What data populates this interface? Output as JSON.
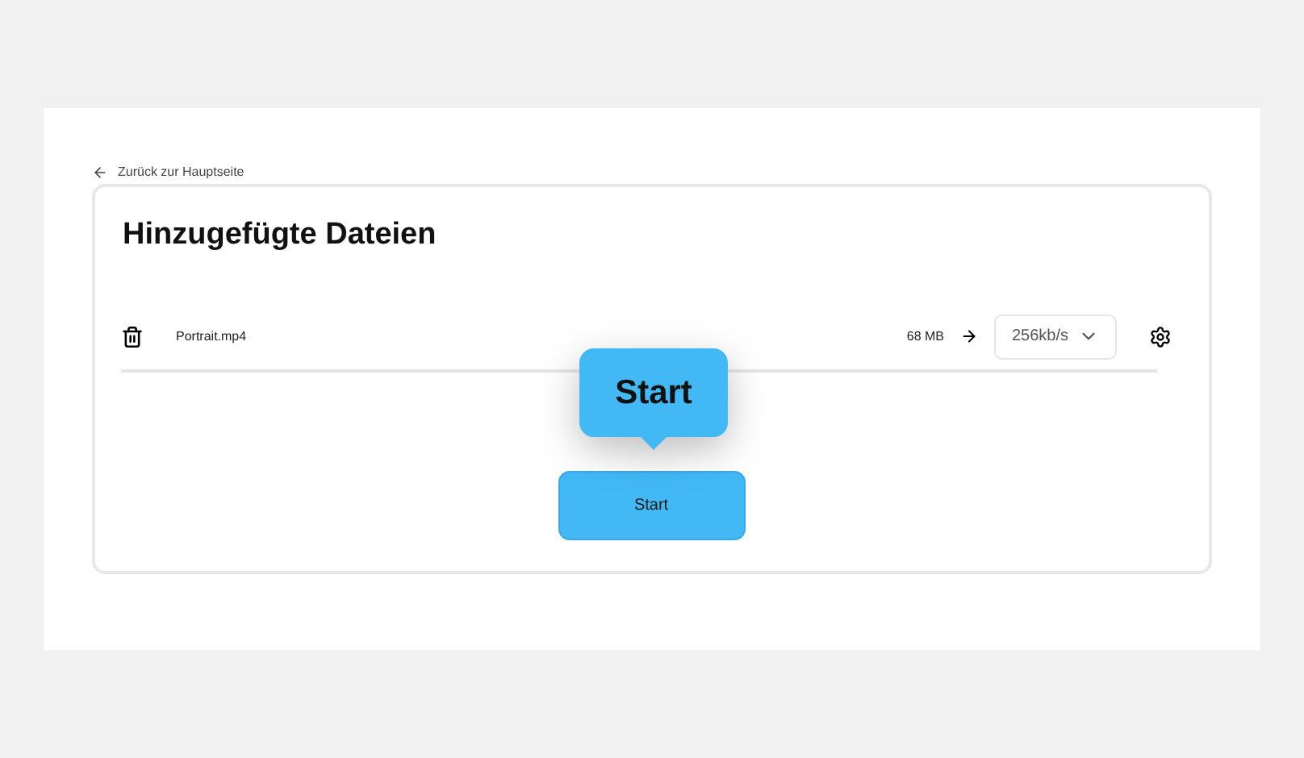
{
  "back_link": "Zurück zur Hauptseite",
  "title": "Hinzugefügte Dateien",
  "files": [
    {
      "name": "Portrait.mp4",
      "size": "68 MB",
      "bitrate": "256kb/s"
    }
  ],
  "start_button": "Start",
  "tooltip": "Start"
}
